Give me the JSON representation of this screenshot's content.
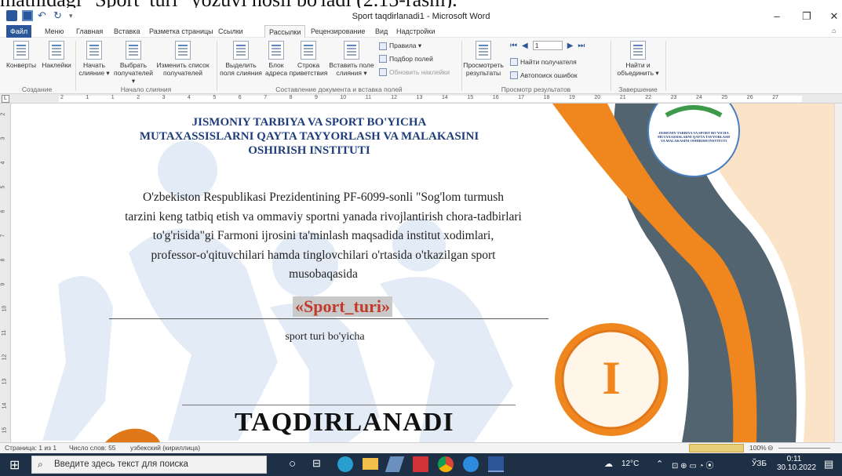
{
  "overlay_text": "matnidagi \"Sport_turi\" yozuvi hosil bo'ladi (2.15-rasm).",
  "window": {
    "title": "Sport taqdirlanadi1 - Microsoft Word",
    "minimize": "–",
    "restore": "❐",
    "close": "✕"
  },
  "menu_tabs": [
    "Файл",
    "Меню",
    "Главная",
    "Вставка",
    "Разметка страницы",
    "Ссылки",
    "Рассылки",
    "Рецензирование",
    "Вид",
    "Надстройки"
  ],
  "ribbon": {
    "envelopes": "Конверты",
    "labels": "Наклейки",
    "start_merge": "Начать слияние ▾",
    "select_recipients": "Выбрать получателей ▾",
    "edit_list": "Изменить список получателей",
    "highlight_fields": "Выделить поля слияния",
    "address_block": "Блок адреса",
    "greeting_line": "Строка приветствия",
    "insert_field": "Вставить поле слияния ▾",
    "rules": "Правила ▾",
    "match_fields": "Подбор полей",
    "update_labels": "Обновить наклейки",
    "preview_results": "Просмотреть результаты",
    "record_value": "1",
    "find_recipient": "Найти получателя",
    "auto_check": "Автопоиск ошибок",
    "find_merge": "Найти и объединить ▾",
    "groups": [
      "Создание",
      "Начало слияния",
      "Составление документа и вставка полей",
      "Просмотр результатов",
      "Завершение"
    ]
  },
  "ruler_ticks": [
    "2",
    "1",
    "1",
    "2",
    "3",
    "4",
    "5",
    "6",
    "7",
    "8",
    "9",
    "10",
    "11",
    "12",
    "13",
    "14",
    "15",
    "16",
    "17",
    "18",
    "19",
    "20",
    "21",
    "22",
    "23",
    "24",
    "25",
    "26",
    "27"
  ],
  "vruler_ticks": [
    "2",
    "3",
    "4",
    "5",
    "6",
    "7",
    "8",
    "9",
    "10",
    "11",
    "12",
    "13",
    "14",
    "15"
  ],
  "document": {
    "institute": [
      "JISMONIY TARBIYA VA SPORT BO'YICHA",
      "MUTAXASSISLARNI QAYTA TAYYORLASH VA MALAKASINI",
      "OSHIRISH INSTITUTI"
    ],
    "paragraph": [
      "O'zbekiston Respublikasi Prezidentining PF-6099-sonli \"Sog'lom turmush",
      "tarzini keng tatbiq etish va ommaviy sportni yanada rivojlantirish chora-tadbirlari",
      "to'g'risida\"gi Farmoni ijrosini ta'minlash maqsadida institut xodimlari,",
      "professor-o'qituvchilari hamda tinglovchilari o'rtasida o'tkazilgan sport",
      "musobaqasida"
    ],
    "merge_field": "«Sport_turi»",
    "caption": "sport turi bo'yicha",
    "award": "TAQDIRLANADI",
    "medal": "I",
    "logo_text": "JISMONIY TARBIYA VA SPORT BO'YICHA MUTAXASSISLARNI QAYTA TAYYORLASH VA MALAKASINI OSHIRISH INSTITUTI"
  },
  "status": {
    "page": "Страница: 1 из 1",
    "words": "Число слов: 55",
    "lang": "узбекский (кириллица)",
    "zoom": "100%"
  },
  "taskbar": {
    "search_placeholder": "Введите здесь текст для поиска",
    "weather": "12°C",
    "lang": "ЎЗБ",
    "time": "0:11",
    "date": "30.10.2022"
  },
  "colors": {
    "word_blue": "#2b579a",
    "field_red": "#c0392b",
    "orange": "#f0871e",
    "slate": "#52646f"
  }
}
